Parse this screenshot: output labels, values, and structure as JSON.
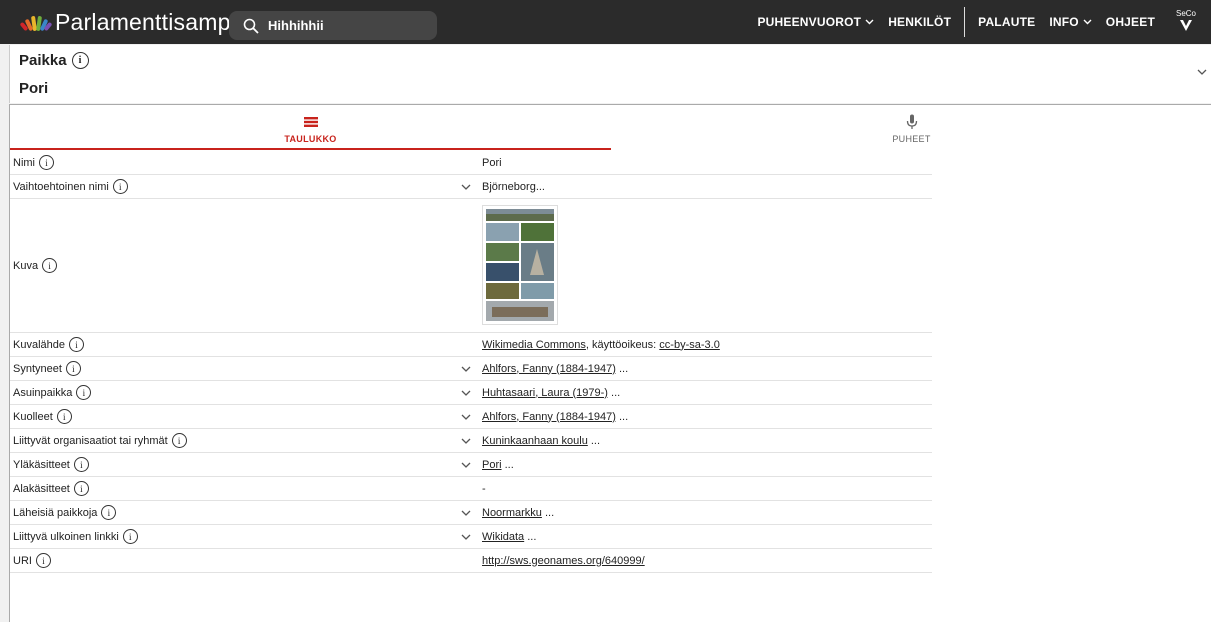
{
  "app": {
    "title": "Parlamenttisampo"
  },
  "search": {
    "value": "Hihhihhii"
  },
  "nav": {
    "items": [
      "PUHEENVUOROT",
      "HENKILÖT",
      "PALAUTE",
      "INFO",
      "OHJEET"
    ],
    "logo_text": "SeCo"
  },
  "header": {
    "label": "Paikka",
    "value": "Pori"
  },
  "tabs": [
    {
      "label": "TAULUKKO",
      "icon": "table-icon"
    },
    {
      "label": "PUHEET",
      "icon": "microphone-icon"
    }
  ],
  "rows": [
    {
      "label": "Nimi",
      "value": "Pori"
    },
    {
      "label": "Vaihtoehtoinen nimi",
      "value": "Björneborg..."
    },
    {
      "label": "Kuva",
      "value": ""
    },
    {
      "label": "Kuvalähde",
      "link1": "Wikimedia Commons",
      "mid": ", käyttöoikeus: ",
      "link2": "cc-by-sa-3.0"
    },
    {
      "label": "Syntyneet",
      "link": "Ahlfors, Fanny (1884-1947)",
      "suffix": " ..."
    },
    {
      "label": "Asuinpaikka",
      "link": "Huhtasaari, Laura (1979-)",
      "suffix": " ..."
    },
    {
      "label": "Kuolleet",
      "link": "Ahlfors, Fanny (1884-1947)",
      "suffix": " ..."
    },
    {
      "label": "Liittyvät organisaatiot tai ryhmät",
      "link": "Kuninkaanhaan koulu",
      "suffix": " ..."
    },
    {
      "label": "Yläkäsitteet",
      "link": "Pori",
      "suffix": " ..."
    },
    {
      "label": "Alakäsitteet",
      "value": "-"
    },
    {
      "label": "Läheisiä paikkoja",
      "link": "Noormarkku",
      "suffix": " ..."
    },
    {
      "label": "Liittyvä ulkoinen linkki",
      "link": "Wikidata",
      "suffix": " ..."
    },
    {
      "label": "URI",
      "link": "http://sws.geonames.org/640999/"
    }
  ],
  "colors": {
    "accent": "#c8231c",
    "topbar": "#2b2b2b"
  }
}
